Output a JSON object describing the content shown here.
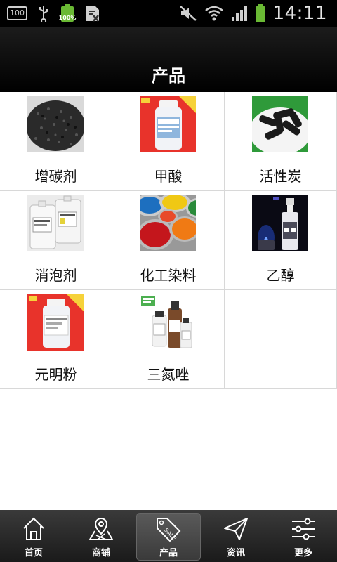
{
  "status_bar": {
    "left_box_text": "100",
    "battery_percent": "100%",
    "clock": "14:11"
  },
  "header": {
    "title": "产品"
  },
  "products": [
    {
      "label": "增碳剂",
      "thumb": "carbon-granules"
    },
    {
      "label": "甲酸",
      "thumb": "reagent-bottle-red"
    },
    {
      "label": "活性炭",
      "thumb": "carbon-pellets"
    },
    {
      "label": "消泡剂",
      "thumb": "white-jerrycans"
    },
    {
      "label": "化工染料",
      "thumb": "paint-cans"
    },
    {
      "label": "乙醇",
      "thumb": "ethanol-bottle"
    },
    {
      "label": "元明粉",
      "thumb": "reagent-bottle-red-2"
    },
    {
      "label": "三氮唑",
      "thumb": "reagent-bottles"
    }
  ],
  "bottom_nav": [
    {
      "label": "首页",
      "icon": "home-icon"
    },
    {
      "label": "商铺",
      "icon": "map-icon"
    },
    {
      "label": "产品",
      "icon": "sale-tag-icon",
      "active": true
    },
    {
      "label": "资讯",
      "icon": "paper-plane-icon"
    },
    {
      "label": "更多",
      "icon": "sliders-icon"
    }
  ]
}
